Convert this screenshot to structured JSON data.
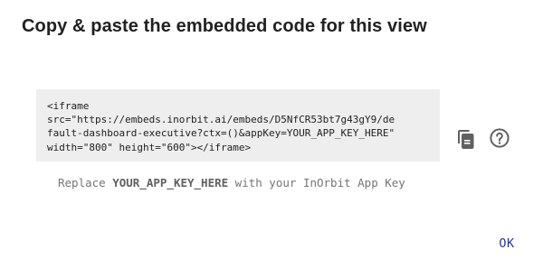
{
  "dialog": {
    "title": "Copy & paste the embedded code for this view",
    "code": "<iframe\nsrc=\"https://embeds.inorbit.ai/embeds/D5NfCR53bt7g43gY9/de\nfault-dashboard-executive?ctx=()&appKey=YOUR_APP_KEY_HERE\"\nwidth=\"800\" height=\"600\"></iframe>",
    "hint": {
      "prefix": "Replace ",
      "key": "YOUR_APP_KEY_HERE",
      "suffix": " with your InOrbit App Key"
    },
    "ok_label": "OK"
  },
  "icons": {
    "copy": "copy-icon",
    "help": "help-circle-icon"
  },
  "colors": {
    "title": "#212121",
    "code_background": "#eeeeee",
    "icon": "#616161",
    "hint": "#757575",
    "ok_button": "#283593"
  }
}
